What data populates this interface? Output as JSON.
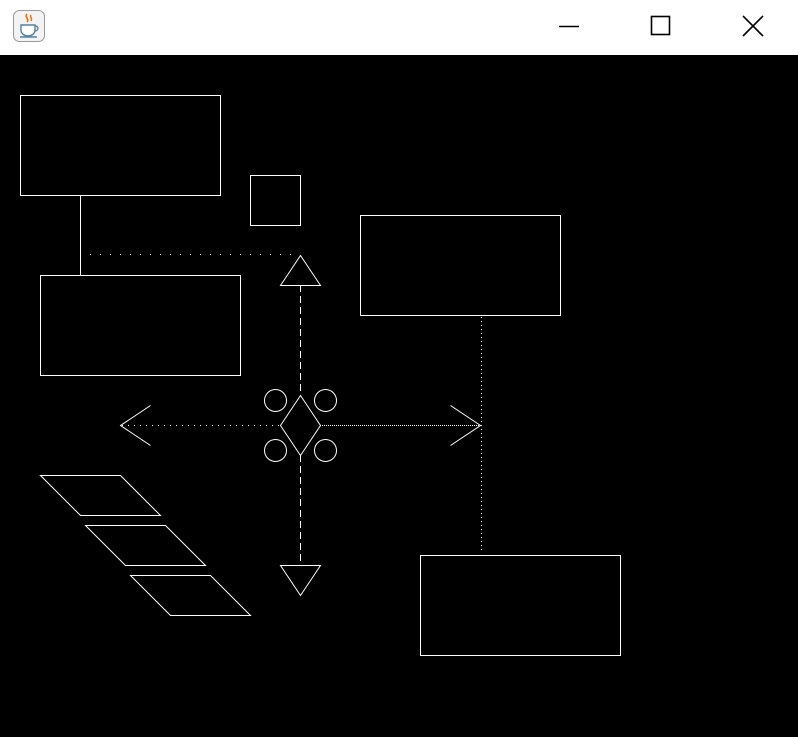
{
  "window": {
    "app_icon": "java-coffee-cup-icon",
    "controls": {
      "minimize_icon": "minimize-icon",
      "maximize_icon": "maximize-icon",
      "close_icon": "close-icon"
    }
  },
  "colors": {
    "titlebar_background": "#ffffff",
    "canvas_background": "#000000",
    "stroke": "#ffffff",
    "icon_cup": "#e76f00",
    "icon_steam": "#5382a1"
  },
  "canvas": {
    "shape_kinds": [
      "rectangle",
      "rectangle",
      "small-square",
      "rectangle",
      "rectangle",
      "rectangle",
      "parallelogram",
      "parallelogram",
      "parallelogram",
      "diamond",
      "circle",
      "circle",
      "circle",
      "circle",
      "arrow-up",
      "arrow-down",
      "arrow-left",
      "arrow-right"
    ]
  }
}
